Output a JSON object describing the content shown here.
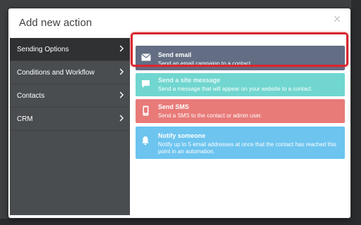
{
  "modal": {
    "title": "Add new action",
    "close_glyph": "×"
  },
  "sidebar": {
    "items": [
      {
        "label": "Sending Options",
        "active": true
      },
      {
        "label": "Conditions and Workflow",
        "active": false
      },
      {
        "label": "Contacts",
        "active": false
      },
      {
        "label": "CRM",
        "active": false
      }
    ]
  },
  "actions": [
    {
      "title": "Send email",
      "description": "Send an email campaign to a contact.",
      "icon": "envelope-icon",
      "color": "#636d83"
    },
    {
      "title": "Send a site message",
      "description": "Send a message that will appear on your website to a contact.",
      "icon": "chat-bubble-icon",
      "color": "#70d6cf"
    },
    {
      "title": "Send SMS",
      "description": "Send a SMS to the contact or admin user.",
      "icon": "mobile-phone-icon",
      "color": "#e87a78"
    },
    {
      "title": "Notify someone",
      "description": "Notify up to 5 email addresses at once that the contact has reached this point in an automation.",
      "icon": "bell-icon",
      "color": "#6cc4ef"
    }
  ],
  "colors": {
    "sidebar_bg": "#4a4d50",
    "sidebar_active_bg": "#2f3133",
    "highlight": "#d8262f"
  }
}
